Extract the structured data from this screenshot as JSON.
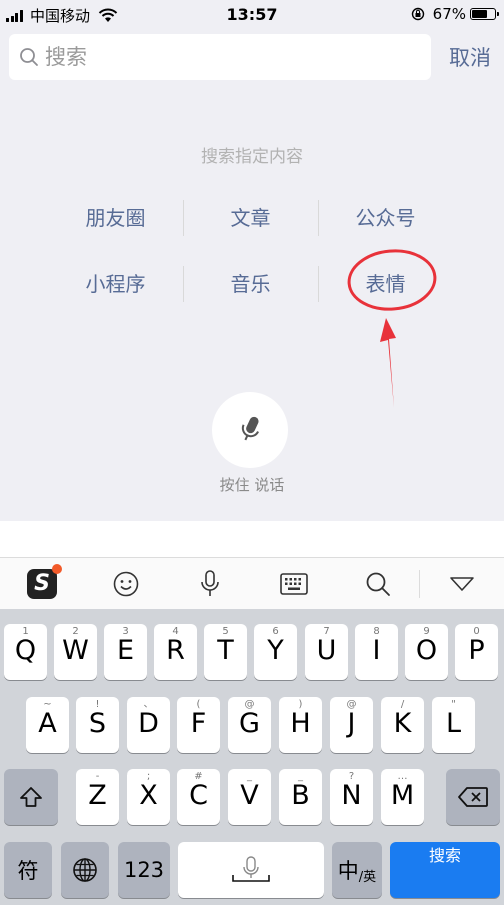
{
  "status_bar": {
    "carrier": "中国移动",
    "time": "13:57",
    "battery_percent": "67%",
    "battery_level": 0.67,
    "icons": [
      "signal-icon",
      "wifi-icon",
      "rotation-lock-icon",
      "battery-icon"
    ]
  },
  "search": {
    "placeholder": "搜索",
    "value": "",
    "cancel_label": "取消"
  },
  "search_hint": "搜索指定内容",
  "categories": [
    [
      "朋友圈",
      "文章",
      "公众号"
    ],
    [
      "小程序",
      "音乐",
      "表情"
    ]
  ],
  "voice": {
    "label": "按住 说话",
    "icon": "microphone-icon"
  },
  "annotation": {
    "color": "#e8323a",
    "target": "表情"
  },
  "keyboard_toolbar": [
    "sogou-logo",
    "emoji-icon",
    "microphone-icon",
    "keyboard-icon",
    "search-icon",
    "collapse-icon"
  ],
  "keyboard": {
    "row1": [
      {
        "letter": "Q",
        "hint": "1"
      },
      {
        "letter": "W",
        "hint": "2"
      },
      {
        "letter": "E",
        "hint": "3"
      },
      {
        "letter": "R",
        "hint": "4"
      },
      {
        "letter": "T",
        "hint": "5"
      },
      {
        "letter": "Y",
        "hint": "6"
      },
      {
        "letter": "U",
        "hint": "7"
      },
      {
        "letter": "I",
        "hint": "8"
      },
      {
        "letter": "O",
        "hint": "9"
      },
      {
        "letter": "P",
        "hint": "0"
      }
    ],
    "row2": [
      {
        "letter": "A",
        "hint": "~"
      },
      {
        "letter": "S",
        "hint": "!"
      },
      {
        "letter": "D",
        "hint": "、"
      },
      {
        "letter": "F",
        "hint": "("
      },
      {
        "letter": "G",
        "hint": "@"
      },
      {
        "letter": "H",
        "hint": ")"
      },
      {
        "letter": "J",
        "hint": "@"
      },
      {
        "letter": "K",
        "hint": "/"
      },
      {
        "letter": "L",
        "hint": "\""
      }
    ],
    "row3": [
      {
        "letter": "Z",
        "hint": "-"
      },
      {
        "letter": "X",
        "hint": ";"
      },
      {
        "letter": "C",
        "hint": "#"
      },
      {
        "letter": "V",
        "hint": "_"
      },
      {
        "letter": "B",
        "hint": "_"
      },
      {
        "letter": "N",
        "hint": "?"
      },
      {
        "letter": "M",
        "hint": "…"
      }
    ],
    "symbol_key": "符",
    "numbers_key": "123",
    "lang_key_main": "中",
    "lang_key_sub": "/英",
    "search_key": "搜索"
  },
  "colors": {
    "link": "#576b95",
    "annotation": "#e8323a",
    "search_key": "#1a7cf1"
  }
}
